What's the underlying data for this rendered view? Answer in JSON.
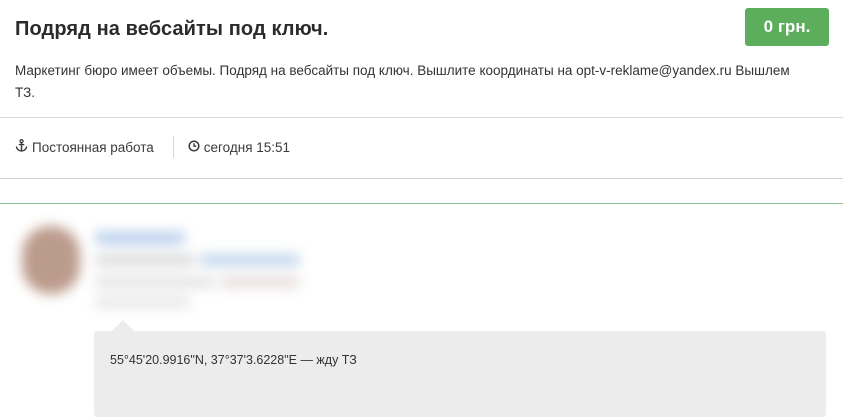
{
  "job": {
    "title": "Подряд на вебсайты под ключ.",
    "price": "0 грн.",
    "description": "Маркетинг бюро имеет объемы. Подряд на вебсайты под ключ. Вышлите координаты на opt-v-reklame@yandex.ru Вышлем ТЗ.",
    "type_label": "Постоянная работа",
    "posted_time": "сегодня 15:51",
    "type_icon": "anchor-icon",
    "time_icon": "clock-icon"
  },
  "bid": {
    "message": "55°45'20.9916\"N, 37°37'3.6228\"E — жду ТЗ"
  },
  "colors": {
    "accent_green": "#5cad5c",
    "bubble_bg": "#ececec"
  }
}
